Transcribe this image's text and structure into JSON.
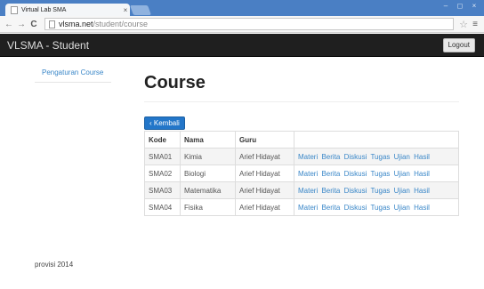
{
  "browser": {
    "tab_title": "Virtual Lab SMA",
    "tab_close": "×",
    "url_host": "vlsma.net",
    "url_path": "/student/course",
    "back": "←",
    "forward": "→",
    "reload": "C",
    "star": "☆",
    "menu": "≡",
    "win_min": "–",
    "win_max": "◻",
    "win_close": "×"
  },
  "navbar": {
    "brand": "VLSMA - Student",
    "logout_label": "Logout"
  },
  "sidebar": {
    "items": [
      {
        "label": "Pengaturan Course"
      }
    ]
  },
  "main": {
    "title": "Course",
    "back_button": "‹ Kembali",
    "table": {
      "headers": [
        "Kode",
        "Nama",
        "Guru",
        ""
      ],
      "rows": [
        {
          "kode": "SMA01",
          "nama": "Kimia",
          "guru": "Arief Hidayat",
          "actions": [
            "Materi",
            "Berita",
            "Diskusi",
            "Tugas",
            "Ujian",
            "Hasil"
          ]
        },
        {
          "kode": "SMA02",
          "nama": "Biologi",
          "guru": "Arief Hidayat",
          "actions": [
            "Materi",
            "Berita",
            "Diskusi",
            "Tugas",
            "Ujian",
            "Hasil"
          ]
        },
        {
          "kode": "SMA03",
          "nama": "Matematika",
          "guru": "Arief Hidayat",
          "actions": [
            "Materi",
            "Berita",
            "Diskusi",
            "Tugas",
            "Ujian",
            "Hasil"
          ]
        },
        {
          "kode": "SMA04",
          "nama": "Fisika",
          "guru": "Arief Hidayat",
          "actions": [
            "Materi",
            "Berita",
            "Diskusi",
            "Tugas",
            "Ujian",
            "Hasil"
          ]
        }
      ]
    }
  },
  "footer": {
    "text": "provisi 2014"
  },
  "colors": {
    "titlebar": "#4a7fc4",
    "navbar": "#1f1f1f",
    "link": "#3a87c8",
    "primary_button": "#2376c9"
  }
}
